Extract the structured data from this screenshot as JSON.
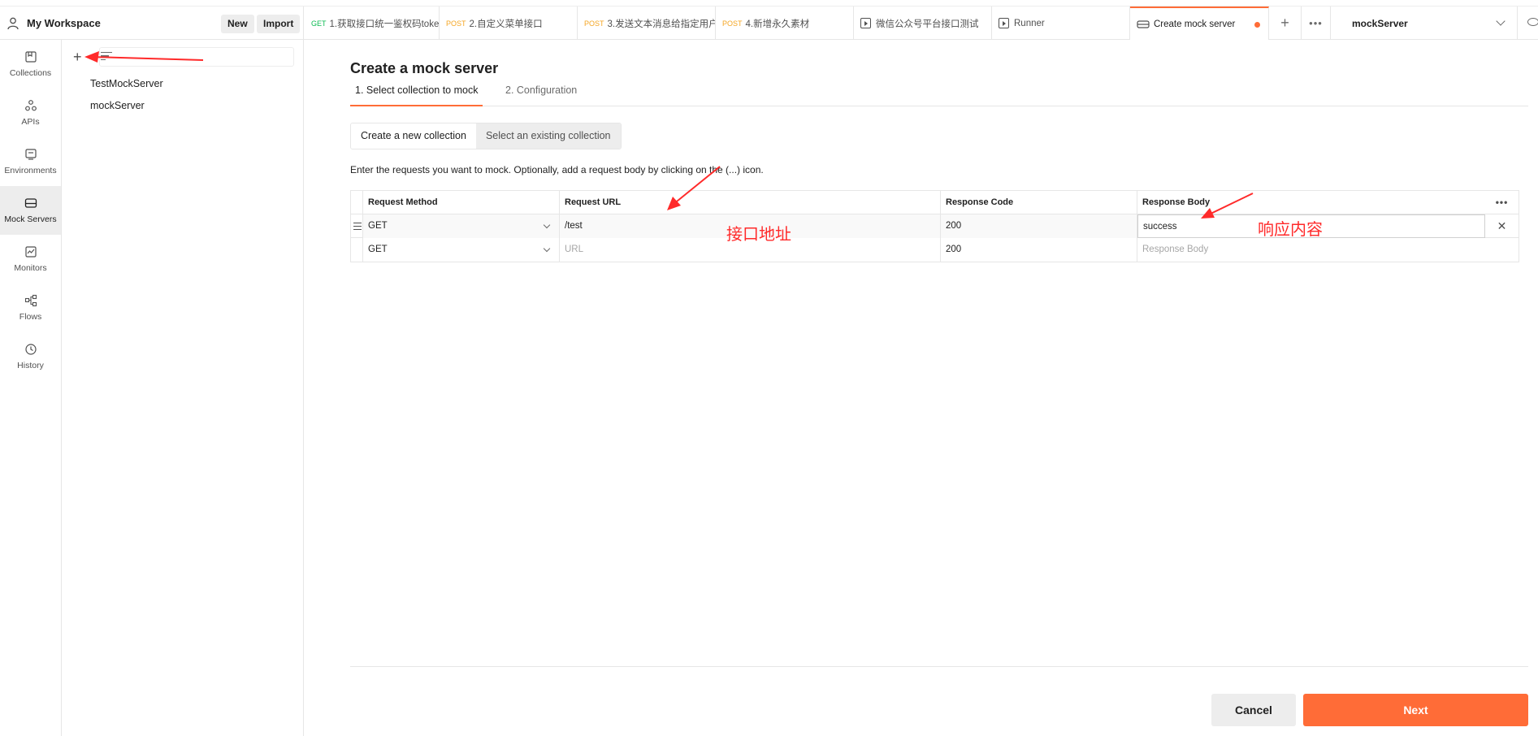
{
  "workspace": {
    "title": "My Workspace",
    "new_label": "New",
    "import_label": "Import"
  },
  "tabs": [
    {
      "method": "GET",
      "label": "1.获取接口统一鉴权码toke"
    },
    {
      "method": "POST",
      "label": "2.自定义菜单接口"
    },
    {
      "method": "POST",
      "label": "3.发送文本消息给指定用户"
    },
    {
      "method": "POST",
      "label": "4.新增永久素材"
    },
    {
      "method": "",
      "label": "微信公众号平台接口测试"
    },
    {
      "method": "",
      "label": "Runner"
    },
    {
      "method": "",
      "label": "Create mock server"
    }
  ],
  "environment": {
    "selected": "mockServer"
  },
  "rail": [
    {
      "label": "Collections"
    },
    {
      "label": "APIs"
    },
    {
      "label": "Environments"
    },
    {
      "label": "Mock Servers"
    },
    {
      "label": "Monitors"
    },
    {
      "label": "Flows"
    },
    {
      "label": "History"
    }
  ],
  "sidebar": {
    "items": [
      "TestMockServer",
      "mockServer"
    ]
  },
  "main": {
    "title": "Create a mock server",
    "steps": [
      "1.  Select collection to mock",
      "2.  Configuration"
    ],
    "segments": [
      "Create a new collection",
      "Select an existing collection"
    ],
    "description": "Enter the requests you want to mock. Optionally, add a request body by clicking on the (...) icon.",
    "columns": [
      "Request Method",
      "Request URL",
      "Response Code",
      "Response Body"
    ],
    "rows": [
      {
        "method": "GET",
        "url": "/test",
        "code": "200",
        "body": "success"
      },
      {
        "method": "GET",
        "url": "",
        "code": "200",
        "body": ""
      }
    ],
    "placeholders": {
      "url": "URL",
      "body": "Response Body"
    },
    "cancel_label": "Cancel",
    "next_label": "Next"
  },
  "annotations": {
    "url_note": "接口地址",
    "body_note": "响应内容",
    "color": "#ff2a2a"
  },
  "colors": {
    "accent": "#ff6c37",
    "get": "#0cbb52",
    "post": "#f5a623"
  }
}
